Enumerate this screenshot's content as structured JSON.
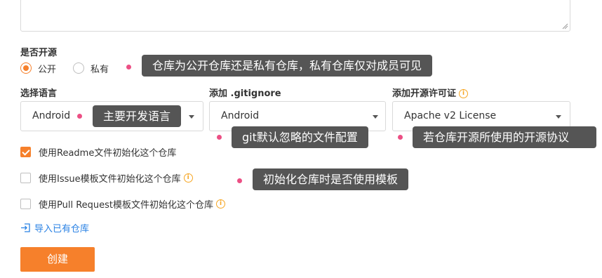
{
  "description_area": {
    "value": ""
  },
  "visibility": {
    "label": "是否开源",
    "options": [
      {
        "label": "公开",
        "checked": true
      },
      {
        "label": "私有",
        "checked": false
      }
    ],
    "tip": "仓库为公开仓库还是私有仓库，私有仓库仅对成员可见"
  },
  "language": {
    "label": "选择语言",
    "value": "Android",
    "tip": "主要开发语言"
  },
  "gitignore": {
    "label": "添加 .gitignore",
    "value": "Android",
    "tip": "git默认忽略的文件配置"
  },
  "license": {
    "label": "添加开源许可证",
    "value": "Apache v2 License",
    "tip": "若仓库开源所使用的开源协议"
  },
  "init_options": [
    {
      "label": "使用Readme文件初始化这个仓库",
      "checked": true,
      "info": false
    },
    {
      "label": "使用Issue模板文件初始化这个仓库",
      "checked": false,
      "info": true
    },
    {
      "label": "使用Pull Request模板文件初始化这个仓库",
      "checked": false,
      "info": true
    }
  ],
  "template_tip": "初始化仓库时是否使用模板",
  "import_link": "导入已有仓库",
  "create_button": "创建",
  "colors": {
    "accent": "#f6802b",
    "tip_bg": "#555555",
    "dot": "#ec4f84",
    "link": "#2a82e4",
    "info": "#f6a623"
  },
  "icons": {
    "info": "info-icon",
    "import": "import-icon",
    "caret": "caret-down-icon"
  }
}
